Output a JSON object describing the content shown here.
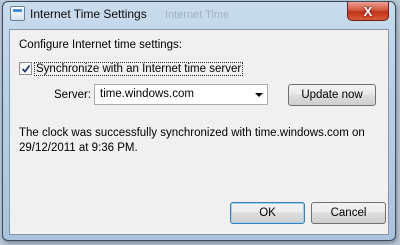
{
  "window": {
    "title": "Internet Time Settings",
    "background_ghost_text": "Internet Time",
    "close_symbol": "X"
  },
  "dialog": {
    "heading": "Configure Internet time settings:",
    "sync_checkbox": {
      "label": "Synchronize with an Internet time server",
      "checked": true
    },
    "server": {
      "label": "Server:",
      "value": "time.windows.com"
    },
    "update_button": "Update now",
    "status_line1": "The clock was successfully synchronized with time.windows.com on",
    "status_line2": "29/12/2011 at 9:36 PM.",
    "ok_button": "OK",
    "cancel_button": "Cancel"
  },
  "icons": [
    "window-app-icon",
    "close-icon",
    "checkmark-icon",
    "dropdown-arrow-icon"
  ],
  "colors": {
    "frame": "#b8cfe6",
    "client_background": "#f0f0f0",
    "close_button": "#c0341a",
    "default_button_border": "#3c7fb1"
  }
}
